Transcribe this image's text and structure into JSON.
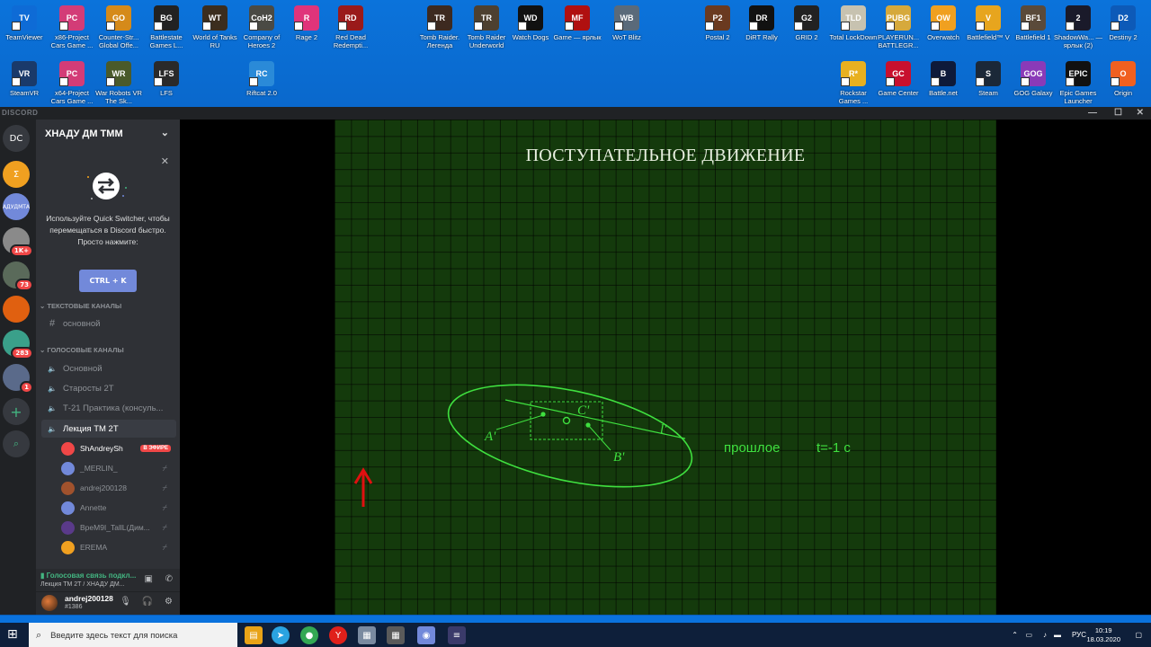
{
  "desktop": {
    "row1": [
      {
        "label": "TeamViewer",
        "color": "#0e6bd6",
        "glyph": "TV"
      },
      {
        "label": "x86-Project Cars Game ...",
        "color": "#d33c77",
        "glyph": "PC"
      },
      {
        "label": "Counter-Str... Global Offe...",
        "color": "#d58a1a",
        "glyph": "GO"
      },
      {
        "label": "Battlestate Games L...",
        "color": "#222222",
        "glyph": "BG"
      },
      {
        "label": "World of Tanks RU",
        "color": "#3b2d1e",
        "glyph": "WT"
      },
      {
        "label": "Company of Heroes 2",
        "color": "#4a4a44",
        "glyph": "CoH2"
      },
      {
        "label": "Rage 2",
        "color": "#e0347a",
        "glyph": "R"
      },
      {
        "label": "Red Dead Redempti...",
        "color": "#9a1a1a",
        "glyph": "RD"
      },
      {
        "label": "Tomb Raider. Легенда",
        "color": "#3d2a20",
        "glyph": "TR"
      },
      {
        "label": "Tomb Raider Underworld",
        "color": "#4d4030",
        "glyph": "TR"
      },
      {
        "label": "Watch Dogs",
        "color": "#111111",
        "glyph": "WD"
      },
      {
        "label": "Game — ярлык",
        "color": "#b01010",
        "glyph": "MF"
      },
      {
        "label": "WoT Blitz",
        "color": "#5a6a7a",
        "glyph": "WB"
      },
      {
        "label": "Postal 2",
        "color": "#6a3a20",
        "glyph": "P2"
      },
      {
        "label": "DiRT Rally",
        "color": "#111111",
        "glyph": "DR"
      },
      {
        "label": "GRID 2",
        "color": "#222222",
        "glyph": "G2"
      },
      {
        "label": "Total LockDown",
        "color": "#c7c2b0",
        "glyph": "TLD"
      },
      {
        "label": "PLAYERUN... BATTLEGR...",
        "color": "#d6a93c",
        "glyph": "PUBG"
      },
      {
        "label": "Overwatch",
        "color": "#f0a020",
        "glyph": "OW"
      },
      {
        "label": "Battlefield™ V",
        "color": "#e7a51e",
        "glyph": "V"
      },
      {
        "label": "Battlefield 1",
        "color": "#5a4a3a",
        "glyph": "BF1"
      },
      {
        "label": "ShadowWa... — ярлык (2)",
        "color": "#1a1a2a",
        "glyph": "2"
      },
      {
        "label": "Destiny 2",
        "color": "#0d5ab8",
        "glyph": "D2"
      }
    ],
    "row2": [
      {
        "label": "SteamVR",
        "color": "#1a3a6a",
        "glyph": "VR"
      },
      {
        "label": "x64-Project Cars Game ...",
        "color": "#d33c77",
        "glyph": "PC"
      },
      {
        "label": "War Robots VR The Sk...",
        "color": "#4a5a2a",
        "glyph": "WR"
      },
      {
        "label": "LFS",
        "color": "#2a2a2a",
        "glyph": "LFS"
      },
      {
        "label": "Riftcat 2.0",
        "color": "#2a8ad8",
        "glyph": "RC"
      },
      {
        "label": "Rockstar Games ...",
        "color": "#e8b020",
        "glyph": "R*"
      },
      {
        "label": "Game Center",
        "color": "#c8102e",
        "glyph": "GC"
      },
      {
        "label": "Battle.net",
        "color": "#0e1a3a",
        "glyph": "B"
      },
      {
        "label": "Steam",
        "color": "#1b2838",
        "glyph": "S"
      },
      {
        "label": "GOG Galaxy",
        "color": "#8a3ab8",
        "glyph": "GOG"
      },
      {
        "label": "Epic Games Launcher",
        "color": "#111111",
        "glyph": "EPIC"
      },
      {
        "label": "Origin",
        "color": "#f06020",
        "glyph": "O"
      }
    ]
  },
  "window": {
    "brand": "DISCORD",
    "controls": {
      "minimize": "—",
      "maximize": "☐",
      "close": "✕"
    }
  },
  "guilds": [
    {
      "label": "DC",
      "color": "#36393f",
      "badge": ""
    },
    {
      "label": "Σ",
      "color": "#f0a020",
      "badge": ""
    },
    {
      "label": "АДУДМТА",
      "color": "#7289da",
      "badge": ""
    },
    {
      "label": "",
      "color": "#8a8a8a",
      "badge": "1K+"
    },
    {
      "label": "",
      "color": "#5a6a5a",
      "badge": "73"
    },
    {
      "label": "",
      "color": "#e06010",
      "badge": ""
    },
    {
      "label": "",
      "color": "#3aa08a",
      "badge": "283"
    },
    {
      "label": "",
      "color": "#5a6a8a",
      "badge": "1"
    }
  ],
  "sidebar": {
    "server_name": "ХНАДУ ДМ ТММ",
    "quick_switcher": {
      "text": "Используйте Quick Switcher, чтобы перемещаться в Discord быстро. Просто нажмите:",
      "button": "CTRL + K"
    },
    "text_category": "ТЕКСТОВЫЕ КАНАЛЫ",
    "text_channels": [
      "основной"
    ],
    "voice_category": "ГОЛОСОВЫЕ КАНАЛЫ",
    "voice_channels": [
      "Основной",
      "Старосты 2Т",
      "Т-21 Практика (консуль...",
      "Лекция ТМ 2Т"
    ],
    "voice_users": [
      {
        "name": "ShAndreySh",
        "badge": "В ЭФИРЕ",
        "color": "#f04747"
      },
      {
        "name": "_MERLIN_",
        "badge": "",
        "color": "#7289da"
      },
      {
        "name": "andrej200128",
        "badge": "",
        "color": "#a0522d"
      },
      {
        "name": "Annette",
        "badge": "",
        "color": "#7289da"
      },
      {
        "name": "BpeM9I_TallL(Дим...",
        "badge": "",
        "color": "#5a3a8a"
      },
      {
        "name": "EREMA",
        "badge": "",
        "color": "#f0a020"
      }
    ],
    "voice_status": "Голосовая связь подкл...",
    "voice_location": "Лекция ТМ 2Т / ХНАДУ ДМ...",
    "user": {
      "name": "andrej200128",
      "tag": "#1386"
    }
  },
  "slide": {
    "title": "ПОСТУПАТЕЛЬНОЕ ДВИЖЕНИЕ",
    "label_a": "A'",
    "label_b": "B'",
    "label_c": "C'",
    "label_l": "l'",
    "label_past": "прошлое",
    "label_time": "t=-1 c"
  },
  "taskbar": {
    "search_placeholder": "Введите здесь текст для поиска",
    "language": "РУС",
    "time": "10:19",
    "date": "18.03.2020"
  }
}
